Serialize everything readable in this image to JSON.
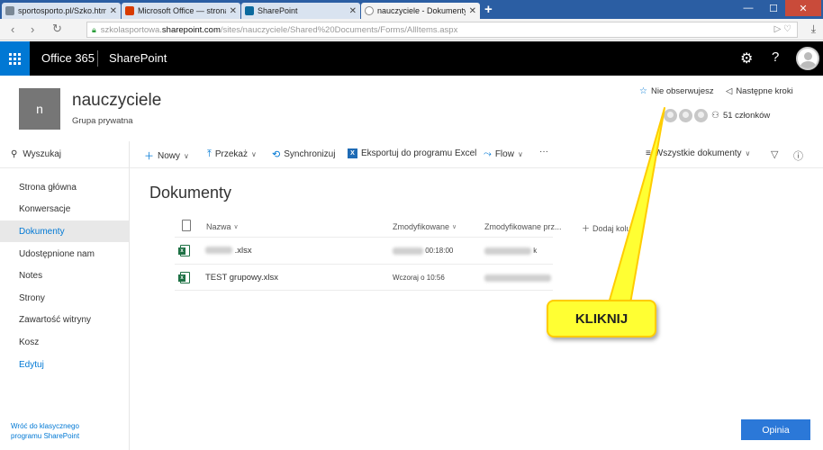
{
  "browser": {
    "tabs": [
      {
        "title": "sportosporto.pl/Szko.htm",
        "color": "#7a8896"
      },
      {
        "title": "Microsoft Office — strona",
        "color": "#d83b01"
      },
      {
        "title": "SharePoint",
        "color": "#0b6a9e"
      },
      {
        "title": "nauczyciele - Dokumenty",
        "color": "#ffffff"
      }
    ],
    "new_tab": "+",
    "window_minimize": "—",
    "window_maximize": "☐",
    "window_close": "✕",
    "back": "‹",
    "forward": "›",
    "reload": "↻",
    "url_prefix": "szkolasportowa.",
    "url_host": "sharepoint.com",
    "url_path": "/sites/nauczyciele/Shared%20Documents/Forms/AllItems.aspx",
    "url_icons": "▷ ♡",
    "download": "⤓"
  },
  "suite": {
    "app_name": "Office 365",
    "product": "SharePoint",
    "help": "?"
  },
  "site": {
    "logo_letter": "n",
    "name": "nauczyciele",
    "type": "Grupa prywatna",
    "follow_label": "Nie obserwujesz",
    "next_steps_label": "Następne kroki",
    "members_label": "51 członków"
  },
  "left_nav": {
    "search_label": "Wyszukaj",
    "items": [
      {
        "label": "Strona główna"
      },
      {
        "label": "Konwersacje"
      },
      {
        "label": "Dokumenty"
      },
      {
        "label": "Udostępnione nam"
      },
      {
        "label": "Notes"
      },
      {
        "label": "Strony"
      },
      {
        "label": "Zawartość witryny"
      },
      {
        "label": "Kosz"
      },
      {
        "label": "Edytuj"
      }
    ],
    "classic_link": "Wróć do klasycznego programu SharePoint"
  },
  "command_bar": {
    "new_label": "Nowy",
    "upload_label": "Przekaż",
    "sync_label": "Synchronizuj",
    "export_label": "Eksportuj do programu Excel",
    "flow_label": "Flow",
    "more": "···",
    "view_label": "Wszystkie dokumenty",
    "info": "ⓘ"
  },
  "library": {
    "title": "Dokumenty",
    "columns": {
      "name": "Nazwa",
      "modified": "Zmodyfikowane",
      "modified_by": "Zmodyfikowane prz...",
      "add_column": "Dodaj kolu..."
    },
    "rows": [
      {
        "name": ".xlsx",
        "modified": "00:18:00",
        "modified_by": "k"
      },
      {
        "name": "TEST grupowy.xlsx",
        "modified": "Wczoraj o 10:56",
        "modified_by": ""
      }
    ]
  },
  "callout": {
    "text": "KLIKNIJ",
    "fill": "#ffff33",
    "border": "#ffcc00"
  },
  "feedback_label": "Opinia"
}
